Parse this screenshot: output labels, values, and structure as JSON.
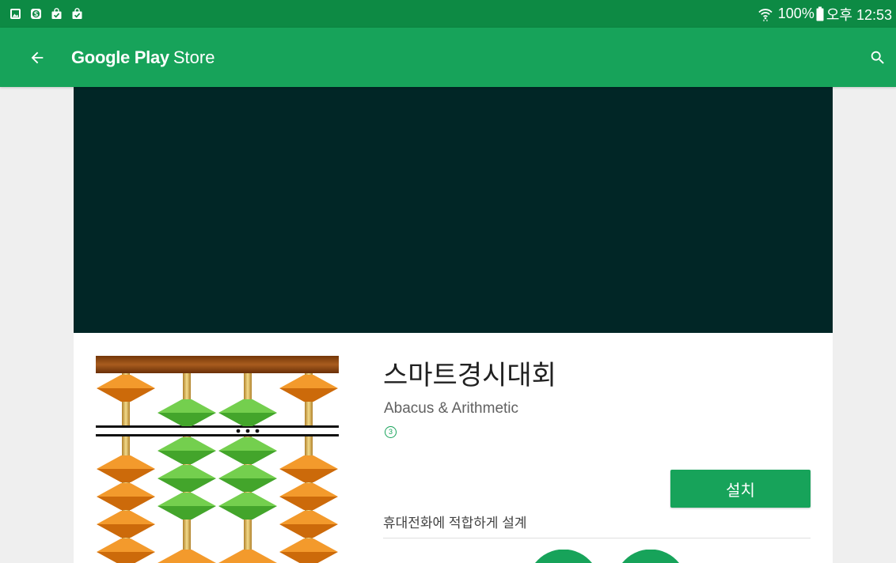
{
  "status_bar": {
    "icons_left": [
      "gallery-icon",
      "app-notification-icon",
      "bag-check-icon",
      "bag-check-icon"
    ],
    "icons_right": [
      "wifi-icon",
      "battery-icon"
    ],
    "battery_percent": "100%",
    "time": "오후 12:53"
  },
  "app_bar": {
    "title_brand": "Google Play",
    "title_suffix": "Store",
    "icons": {
      "back": "back-arrow-icon",
      "search": "search-icon"
    }
  },
  "app": {
    "title": "스마트경시대회",
    "developer": "Abacus & Arithmetic",
    "content_rating": "3",
    "install_label": "설치",
    "device_note": "휴대전화에 적합하게 설계"
  },
  "colors": {
    "status_bar": "#0d8a44",
    "app_bar": "#17a35a",
    "accent": "#17a35a",
    "banner": "#012626",
    "page_bg": "#efefef"
  }
}
